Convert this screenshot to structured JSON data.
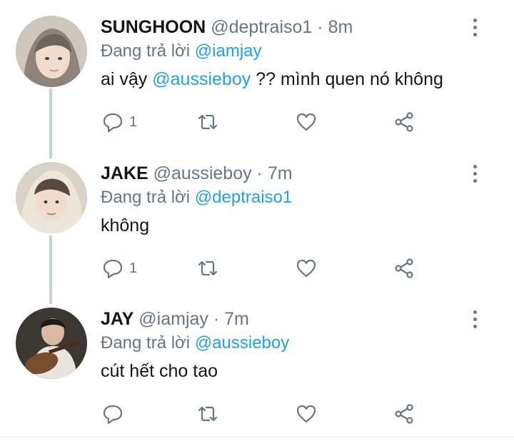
{
  "tweets": [
    {
      "name": "SUNGHOON",
      "handle": "@deptraiso1",
      "separator": "·",
      "time": "8m",
      "replying_prefix": "Đang trả lời",
      "replying_to": "@iamjay",
      "body_before": "ai vậy",
      "body_mention": "@aussieboy",
      "body_after": "?? mình quen nó không",
      "reply_count": "1"
    },
    {
      "name": "JAKE",
      "handle": "@aussieboy",
      "separator": "·",
      "time": "7m",
      "replying_prefix": "Đang trả lời",
      "replying_to": "@deptraiso1",
      "body_before": "không",
      "body_mention": "",
      "body_after": "",
      "reply_count": "1"
    },
    {
      "name": "JAY",
      "handle": "@iamjay",
      "separator": "·",
      "time": "7m",
      "replying_prefix": "Đang trả lời",
      "replying_to": "@aussieboy",
      "body_before": "cút hết cho tao",
      "body_mention": "",
      "body_after": "",
      "reply_count": ""
    }
  ],
  "icons": {
    "reply": "reply-icon",
    "retweet": "retweet-icon",
    "like": "like-icon",
    "share": "share-icon",
    "more": "more-vertical-icon"
  },
  "colors": {
    "text": "#14171a",
    "secondary": "#657786",
    "mention": "#1da1f2",
    "thread_line": "#c8d1d8"
  }
}
